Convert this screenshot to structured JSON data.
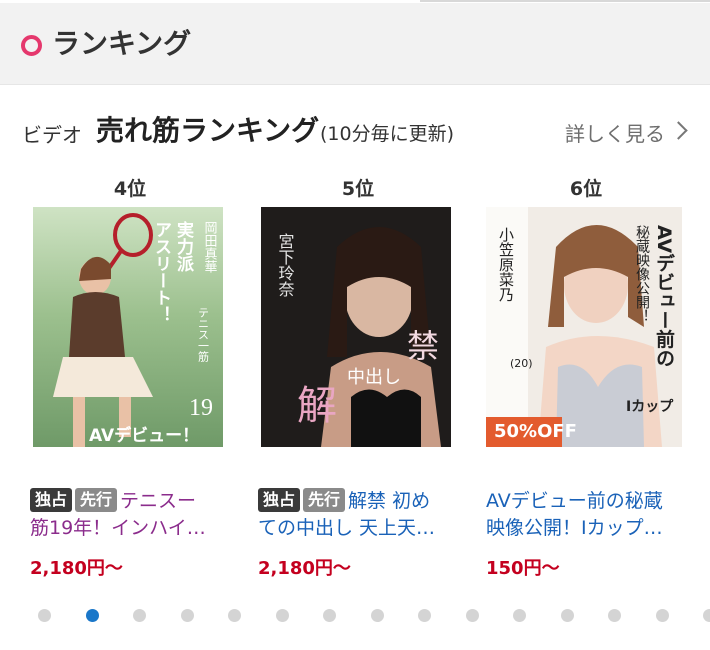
{
  "header": {
    "title": "ランキング",
    "accent": "#e5386d"
  },
  "section": {
    "genre": "ビデオ",
    "title": "売れ筋ランキング",
    "note": "(10分毎に更新)",
    "more": "詳しく見る"
  },
  "cards": [
    {
      "rank": "4位",
      "tags": [
        "独占",
        "先行"
      ],
      "title_line1": "テニスー",
      "title_line2": "筋19年！インハイ…",
      "title_color": "#8b2c8c",
      "price": "2,180円〜",
      "cover": {
        "v1": "実力派",
        "v2": "アスリート！",
        "name": "岡田真華",
        "side": "テニス一筋",
        "age": "19",
        "debut": "AVデビュー！"
      }
    },
    {
      "rank": "5位",
      "tags": [
        "独占",
        "先行"
      ],
      "title_line1": "解禁 初め",
      "title_line2": "ての中出し 天上天…",
      "title_color": "#1a62b8",
      "price": "2,180円〜",
      "cover": {
        "name": "宮下玲奈",
        "kin": "禁",
        "kai": "解",
        "naka": "中出し"
      }
    },
    {
      "rank": "6位",
      "tags": [],
      "title_line1": "AVデビュー前の秘蔵",
      "title_line2": "映像公開！Iカップ…",
      "title_color": "#1a62b8",
      "price": "150円〜",
      "discount": "50%OFF",
      "cover": {
        "name": "小笠原菜乃",
        "age": "(20)",
        "headline": "AVデビュー前の",
        "secret": "秘蔵映像公開！",
        "cup": "Iカップ"
      }
    }
  ],
  "pagination": {
    "count": 15,
    "active_index": 1
  }
}
